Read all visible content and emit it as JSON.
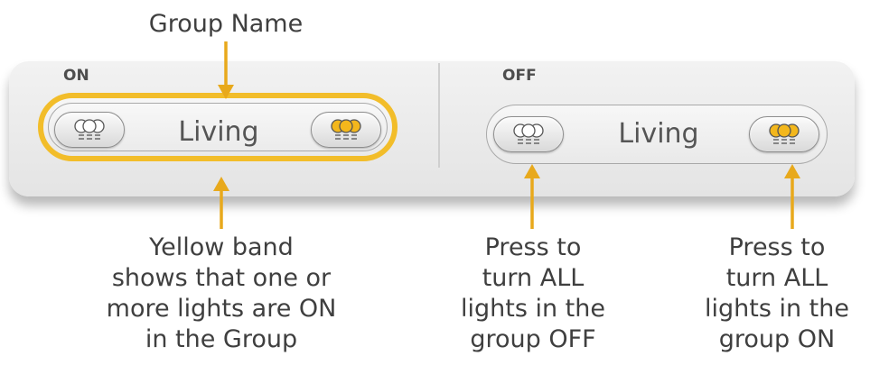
{
  "annotations": {
    "group_name": "Group Name",
    "yellow_band": "Yellow band\nshows that one or\nmore lights are ON\nin the Group",
    "press_off": "Press to\nturn ALL\nlights  in the\ngroup OFF",
    "press_on": "Press to\nturn ALL\nlights  in the\ngroup ON"
  },
  "on_panel": {
    "state_label": "ON",
    "group_name": "Living"
  },
  "off_panel": {
    "state_label": "OFF",
    "group_name": "Living"
  },
  "colors": {
    "accent_yellow": "#f2bd2a",
    "arrow": "#e8a91c",
    "bulb_off": "#ffffff",
    "bulb_on": "#f3b71c"
  },
  "icons": {
    "all_off": "bulbs-off-icon",
    "all_on": "bulbs-on-icon"
  }
}
